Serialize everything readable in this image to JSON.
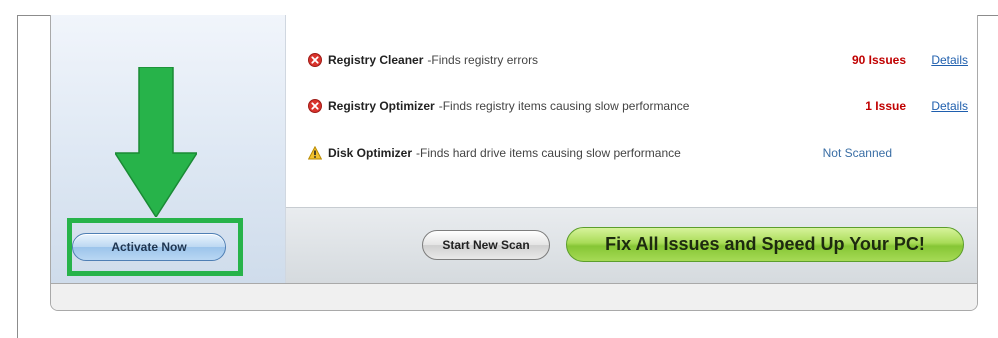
{
  "sidebar": {
    "activate_label": "Activate Now",
    "arrow_color": "#27b34a",
    "highlight_color": "#27b34a"
  },
  "issues": [
    {
      "title": "Registry Cleaner",
      "description": "-Finds registry errors",
      "status_icon": "error-icon",
      "count": "90 Issues",
      "link": "Details"
    },
    {
      "title": "Registry Optimizer",
      "description": "-Finds registry items causing slow performance",
      "status_icon": "error-icon",
      "count": "1 Issue",
      "link": "Details"
    },
    {
      "title": "Disk Optimizer",
      "description": "-Finds hard drive items causing slow performance",
      "status_icon": "warning-icon",
      "status": "Not Scanned"
    }
  ],
  "footer": {
    "scan_label": "Start New Scan",
    "fix_label": "Fix All Issues and Speed Up Your PC!"
  },
  "colors": {
    "issue_count": "#c00000",
    "link": "#1f5fae",
    "fix_button": "#9ad24a"
  }
}
